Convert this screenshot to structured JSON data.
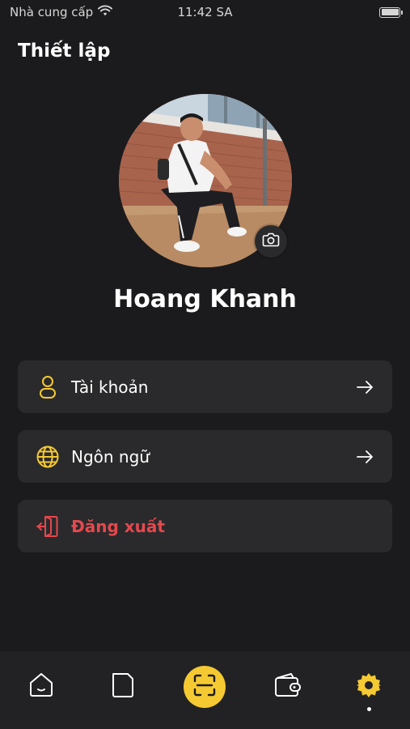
{
  "status_bar": {
    "carrier": "Nhà cung cấp",
    "time": "11:42 SA",
    "wifi_icon": "wifi-icon",
    "battery_icon": "battery-icon"
  },
  "header": {
    "title": "Thiết lập"
  },
  "profile": {
    "name": "Hoang Khanh",
    "camera_icon": "camera-icon"
  },
  "menu": {
    "account": {
      "label": "Tài khoản",
      "icon": "user-icon"
    },
    "language": {
      "label": "Ngôn ngữ",
      "icon": "globe-icon"
    },
    "logout": {
      "label": "Đăng xuất",
      "icon": "logout-icon"
    }
  },
  "tab_bar": {
    "items": [
      {
        "name": "home",
        "icon": "home-icon"
      },
      {
        "name": "documents",
        "icon": "document-icon"
      },
      {
        "name": "scan",
        "icon": "scan-icon"
      },
      {
        "name": "wallet",
        "icon": "wallet-icon"
      },
      {
        "name": "settings",
        "icon": "gear-icon",
        "active": true
      }
    ]
  },
  "colors": {
    "background": "#1b1b1d",
    "card": "#2a2a2c",
    "accent": "#f5c932",
    "danger": "#e5484d",
    "tab_bar": "#222224"
  }
}
